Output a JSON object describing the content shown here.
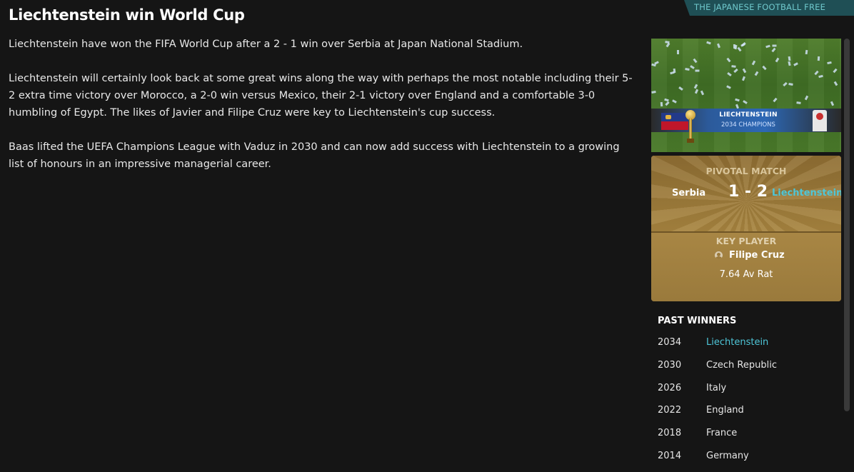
{
  "headline": "Liechtenstein win World Cup",
  "press_tag": "THE JAPANESE FOOTBALL FREE PRESS",
  "article": {
    "paragraphs": [
      "Liechtenstein have won the FIFA World Cup after a 2 - 1 win over Serbia at Japan National Stadium.",
      "Liechtenstein will certainly look back at some great wins along the way with perhaps the most notable including their 5-2 extra time victory over Morocco, a 2-0 win versus Mexico, their 2-1 victory over England and a comfortable 3-0 humbling of Egypt. The likes of Javier and Filipe Cruz were key to Liechtenstein's cup success.",
      "Baas lifted the UEFA Champions League with Vaduz in 2030 and can now add success with Liechtenstein to a growing list of honours in an impressive managerial career."
    ]
  },
  "banner": {
    "title": "LIECHTENSTEIN",
    "subtitle": "2034 CHAMPIONS"
  },
  "pivotal_match": {
    "label": "PIVOTAL MATCH",
    "home_team": "Serbia",
    "score": "1 - 2",
    "away_team": "Liechtenstein"
  },
  "key_player": {
    "label": "KEY PLAYER",
    "name": "Filipe Cruz",
    "rating": "7.64 Av Rat"
  },
  "past_winners": {
    "title": "PAST WINNERS",
    "rows": [
      {
        "year": "2034",
        "team": "Liechtenstein"
      },
      {
        "year": "2030",
        "team": "Czech Republic"
      },
      {
        "year": "2026",
        "team": "Italy"
      },
      {
        "year": "2022",
        "team": "England"
      },
      {
        "year": "2018",
        "team": "France"
      },
      {
        "year": "2014",
        "team": "Germany"
      }
    ]
  },
  "colors": {
    "background": "#151515",
    "accent_link": "#4ec6d8",
    "gold_panel": "#9c7a3b",
    "press_tag_bg": "#1f4f55"
  }
}
